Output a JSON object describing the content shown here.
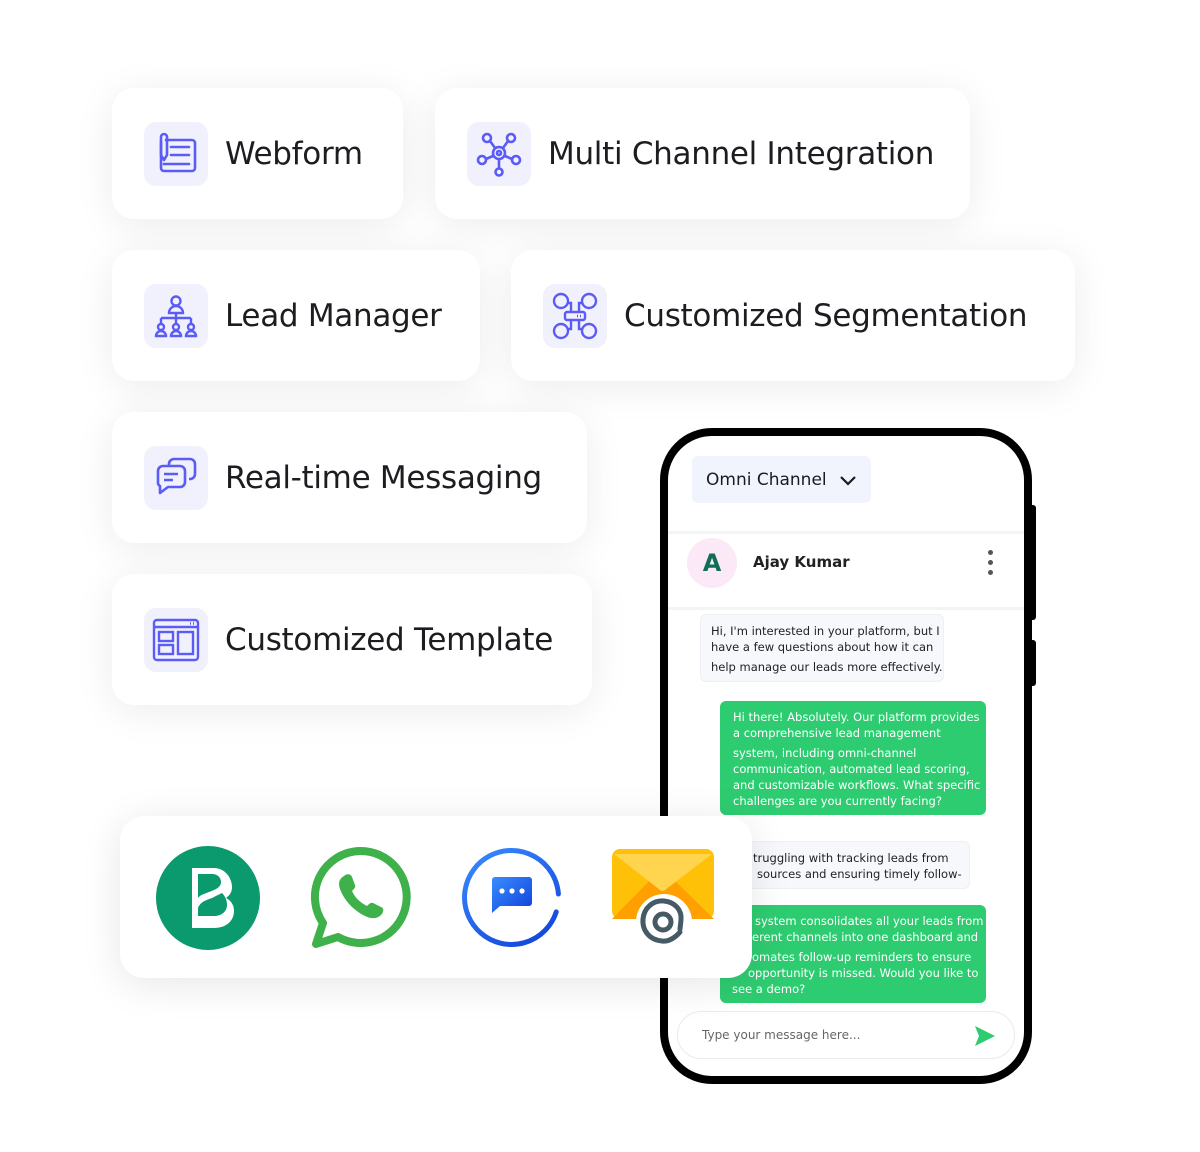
{
  "features": [
    {
      "label": "Webform",
      "icon": "webform-icon"
    },
    {
      "label": "Multi Channel Integration",
      "icon": "network-hub-icon"
    },
    {
      "label": "Lead Manager",
      "icon": "org-chart-icon"
    },
    {
      "label": "Customized Segmentation",
      "icon": "segmentation-icon"
    },
    {
      "label": "Real-time Messaging",
      "icon": "chat-bubbles-icon"
    },
    {
      "label": "Customized Template",
      "icon": "template-layout-icon"
    }
  ],
  "phone": {
    "channel_select": "Omni Channel",
    "contact": {
      "initial": "A",
      "name": "Ajay Kumar"
    },
    "messages": [
      {
        "from": "contact",
        "lines": [
          "Hi, I'm interested in your platform, but I",
          "have a few questions about how it can",
          "help manage our leads more effectively."
        ]
      },
      {
        "from": "agent",
        "lines": [
          "Hi there! Absolutely. Our platform provides",
          "a comprehensive lead management",
          "system, including omni-channel",
          "communication, automated lead scoring,",
          "and customizable workflows. What specific",
          "challenges are you currently facing?"
        ]
      },
      {
        "from": "contact",
        "lines": [
          "truggling with tracking leads from",
          "sources and ensuring timely follow-"
        ]
      },
      {
        "from": "agent",
        "lines": [
          "system consolidates all your leads from",
          "erent channels into one dashboard and",
          "omates follow-up reminders to ensure",
          "opportunity is missed. Would you like to",
          "see a demo?"
        ]
      }
    ],
    "input_placeholder": "Type your message here..."
  },
  "channels": [
    {
      "icon": "brevo-icon",
      "color": "#0b996e"
    },
    {
      "icon": "whatsapp-icon",
      "color": "#3fb14a"
    },
    {
      "icon": "messenger-chat-icon",
      "color": "#1a5ce6"
    },
    {
      "icon": "email-at-icon",
      "color": "#ffc107"
    }
  ],
  "colors": {
    "accent": "#5b5bf5",
    "green": "#2ecc71"
  }
}
